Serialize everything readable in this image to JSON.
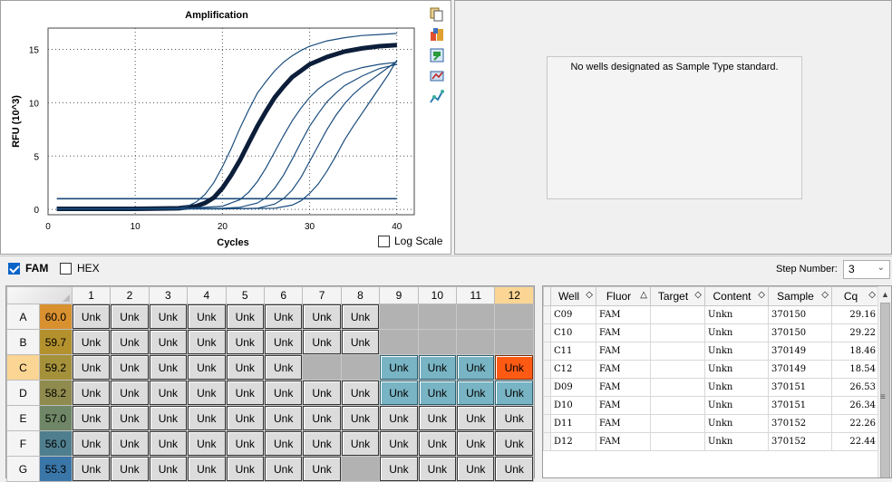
{
  "chart": {
    "title": "Amplification",
    "xlabel": "Cycles",
    "ylabel": "RFU (10^3)",
    "log_scale_label": "Log Scale",
    "log_scale_checked": false
  },
  "chart_data": {
    "type": "line",
    "title": "Amplification",
    "xlabel": "Cycles",
    "ylabel": "RFU (10^3)",
    "xlim": [
      0,
      42
    ],
    "ylim": [
      -0.5,
      17
    ],
    "xticks": [
      0,
      10,
      20,
      30,
      40
    ],
    "yticks": [
      0,
      5,
      10,
      15
    ],
    "grid": true,
    "threshold": 1.0,
    "series": [
      {
        "x": [
          1,
          5,
          10,
          15,
          17,
          18,
          19,
          20,
          21,
          22,
          23,
          24,
          25,
          26,
          27,
          28,
          29,
          30,
          32,
          34,
          36,
          38,
          40
        ],
        "y": [
          0.05,
          0.05,
          0.05,
          0.1,
          0.3,
          0.6,
          1.1,
          2.0,
          3.2,
          4.6,
          6.2,
          7.8,
          9.2,
          10.5,
          11.5,
          12.4,
          13.0,
          13.6,
          14.3,
          14.8,
          15.1,
          15.3,
          15.4
        ]
      },
      {
        "x": [
          1,
          5,
          10,
          15,
          17,
          18,
          19,
          20,
          21,
          22,
          23,
          24,
          25,
          26,
          27,
          28,
          29,
          30,
          32,
          34,
          36,
          38,
          40
        ],
        "y": [
          0.05,
          0.05,
          0.05,
          0.1,
          0.3,
          0.6,
          1.1,
          2.0,
          3.2,
          4.6,
          6.2,
          7.8,
          9.2,
          10.5,
          11.5,
          12.4,
          13.0,
          13.6,
          14.3,
          14.8,
          15.1,
          15.3,
          15.4
        ]
      },
      {
        "x": [
          1,
          10,
          15,
          16,
          17,
          18,
          19,
          20,
          21,
          22,
          23,
          24,
          25,
          26,
          27,
          28,
          29,
          30,
          32,
          34,
          36,
          38,
          40
        ],
        "y": [
          0.05,
          0.05,
          0.1,
          0.3,
          0.7,
          1.4,
          2.5,
          4.0,
          5.7,
          7.6,
          9.3,
          10.9,
          12.0,
          13.0,
          13.8,
          14.4,
          14.9,
          15.3,
          15.8,
          16.1,
          16.3,
          16.4,
          16.5
        ]
      },
      {
        "x": [
          1,
          10,
          15,
          20,
          22,
          23,
          24,
          25,
          26,
          27,
          28,
          29,
          30,
          31,
          32,
          34,
          36,
          38,
          40
        ],
        "y": [
          0.05,
          0.05,
          0.05,
          0.3,
          0.9,
          1.6,
          2.6,
          3.9,
          5.4,
          6.9,
          8.3,
          9.5,
          10.5,
          11.3,
          11.9,
          12.8,
          13.3,
          13.6,
          13.8
        ]
      },
      {
        "x": [
          1,
          10,
          20,
          22,
          24,
          25,
          26,
          27,
          28,
          29,
          30,
          31,
          32,
          33,
          34,
          36,
          38,
          40
        ],
        "y": [
          0.05,
          0.05,
          0.1,
          0.2,
          0.6,
          1.1,
          2.0,
          3.2,
          4.7,
          6.3,
          7.8,
          9.0,
          10.1,
          10.9,
          11.6,
          12.5,
          13.2,
          13.6
        ]
      },
      {
        "x": [
          1,
          10,
          20,
          24,
          26,
          27,
          28,
          29,
          30,
          31,
          32,
          33,
          34,
          35,
          36,
          38,
          40
        ],
        "y": [
          0.05,
          0.05,
          0.05,
          0.1,
          0.5,
          1.0,
          1.8,
          3.0,
          4.5,
          6.0,
          7.5,
          8.8,
          9.9,
          10.8,
          11.5,
          12.7,
          13.9
        ]
      },
      {
        "x": [
          1,
          10,
          20,
          26,
          28,
          29,
          30,
          31,
          32,
          33,
          34,
          35,
          36,
          37,
          38,
          39,
          40
        ],
        "y": [
          0.05,
          0.05,
          0.05,
          0.1,
          0.4,
          0.8,
          1.5,
          2.4,
          3.6,
          5.0,
          6.5,
          7.8,
          9.0,
          10.2,
          11.4,
          12.6,
          14.0
        ]
      }
    ]
  },
  "toolbar_icons": [
    "copy-icon",
    "export-icon",
    "save-chart-icon",
    "print-icon",
    "graph-icon"
  ],
  "std_panel": {
    "message": "No wells designated as Sample Type standard."
  },
  "fluor": {
    "fam_label": "FAM",
    "fam_checked": true,
    "hex_label": "HEX",
    "hex_checked": false,
    "step_label": "Step Number:",
    "step_value": "3"
  },
  "plate": {
    "columns": [
      "1",
      "2",
      "3",
      "4",
      "5",
      "6",
      "7",
      "8",
      "9",
      "10",
      "11",
      "12"
    ],
    "highlight_col": "12",
    "highlight_row": "C",
    "rows": [
      {
        "label": "A",
        "temp": "60.0",
        "color": "#d9902f",
        "wells": [
          "Unk",
          "Unk",
          "Unk",
          "Unk",
          "Unk",
          "Unk",
          "Unk",
          "Unk",
          "",
          "",
          "",
          ""
        ]
      },
      {
        "label": "B",
        "temp": "59.7",
        "color": "#b3912d",
        "wells": [
          "Unk",
          "Unk",
          "Unk",
          "Unk",
          "Unk",
          "Unk",
          "Unk",
          "Unk",
          "",
          "",
          "",
          ""
        ]
      },
      {
        "label": "C",
        "temp": "59.2",
        "color": "#a5913a",
        "wells": [
          "Unk",
          "Unk",
          "Unk",
          "Unk",
          "Unk",
          "Unk",
          "",
          "",
          "Unk",
          "Unk",
          "Unk",
          "Unk"
        ]
      },
      {
        "label": "D",
        "temp": "58.2",
        "color": "#8f8a4d",
        "wells": [
          "Unk",
          "Unk",
          "Unk",
          "Unk",
          "Unk",
          "Unk",
          "Unk",
          "Unk",
          "Unk",
          "Unk",
          "Unk",
          "Unk"
        ]
      },
      {
        "label": "E",
        "temp": "57.0",
        "color": "#6f8766",
        "wells": [
          "Unk",
          "Unk",
          "Unk",
          "Unk",
          "Unk",
          "Unk",
          "Unk",
          "Unk",
          "Unk",
          "Unk",
          "Unk",
          "Unk"
        ]
      },
      {
        "label": "F",
        "temp": "56.0",
        "color": "#4f7f8f",
        "wells": [
          "Unk",
          "Unk",
          "Unk",
          "Unk",
          "Unk",
          "Unk",
          "Unk",
          "Unk",
          "Unk",
          "Unk",
          "Unk",
          "Unk"
        ]
      },
      {
        "label": "G",
        "temp": "55.3",
        "color": "#3a76a8",
        "wells": [
          "Unk",
          "Unk",
          "Unk",
          "Unk",
          "Unk",
          "Unk",
          "Unk",
          "",
          "Unk",
          "Unk",
          "Unk",
          "Unk"
        ]
      }
    ],
    "selected_wells": [
      "C9",
      "C10",
      "C11",
      "D9",
      "D10",
      "D11",
      "D12"
    ],
    "active_well": "C12"
  },
  "grid": {
    "headers": [
      "Well",
      "Fluor",
      "Target",
      "Content",
      "Sample",
      "Cq"
    ],
    "rows": [
      [
        "C09",
        "FAM",
        "",
        "Unkn",
        "370150",
        "29.16"
      ],
      [
        "C10",
        "FAM",
        "",
        "Unkn",
        "370150",
        "29.22"
      ],
      [
        "C11",
        "FAM",
        "",
        "Unkn",
        "370149",
        "18.46"
      ],
      [
        "C12",
        "FAM",
        "",
        "Unkn",
        "370149",
        "18.54"
      ],
      [
        "D09",
        "FAM",
        "",
        "Unkn",
        "370151",
        "26.53"
      ],
      [
        "D10",
        "FAM",
        "",
        "Unkn",
        "370151",
        "26.34"
      ],
      [
        "D11",
        "FAM",
        "",
        "Unkn",
        "370152",
        "22.26"
      ],
      [
        "D12",
        "FAM",
        "",
        "Unkn",
        "370152",
        "22.44"
      ]
    ]
  }
}
